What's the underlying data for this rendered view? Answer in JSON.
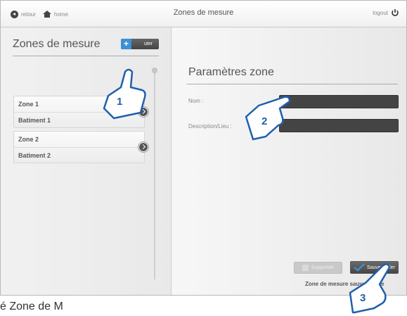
{
  "topbar": {
    "back_label": "retour",
    "home_label": "home",
    "title": "Zones de mesure",
    "logout_label": "logout"
  },
  "left": {
    "title": "Zones de mesure",
    "add_label": "uter",
    "zones": [
      {
        "name": "Zone 1",
        "location": "Batiment 1"
      },
      {
        "name": "Zone 2",
        "location": "Batiment 2"
      }
    ]
  },
  "right": {
    "title": "Paramètres zone",
    "name_label": "Nom :",
    "name_value": "",
    "desc_label": "Description/Lieu :",
    "desc_value": "",
    "delete_label": "Supprimer",
    "save_label": "Sauvegarder",
    "saved_msg": "Zone de mesure sauvegardée"
  },
  "annotations": [
    "1",
    "2",
    "3"
  ],
  "caption": "é Zone de M",
  "colors": {
    "accent_blue": "#2a6fc0",
    "button_dark": "#555555"
  }
}
